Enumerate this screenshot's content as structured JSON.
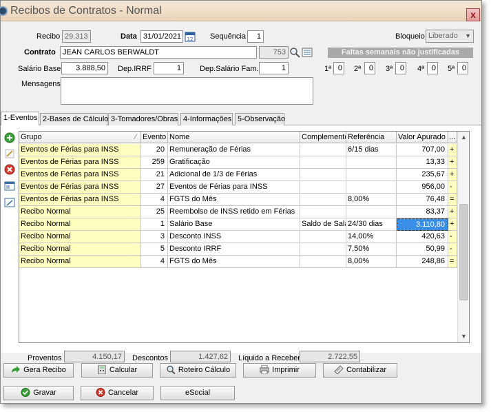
{
  "window": {
    "title": "Recibos de Contratos - Normal",
    "close_label": "x"
  },
  "header": {
    "recibo_label": "Recibo",
    "recibo_value": "29.313",
    "data_label": "Data",
    "data_value": "31/01/2021",
    "sequencia_label": "Sequência",
    "sequencia_value": "1",
    "bloqueio_label": "Bloqueio",
    "bloqueio_value": "Liberado",
    "contrato_label": "Contrato",
    "contrato_value": "JEAN CARLOS BERWALDT",
    "contrato_code": "753",
    "faltas_label": "Faltas semanais não justificadas",
    "salario_label": "Salário Base",
    "salario_value": "3.888,50",
    "depirrf_label": "Dep.IRRF",
    "depirrf_value": "1",
    "depsal_label": "Dep.Salário Fam.",
    "depsal_value": "1",
    "weeks": [
      {
        "label": "1ª",
        "value": "0"
      },
      {
        "label": "2ª",
        "value": "0"
      },
      {
        "label": "3ª",
        "value": "0"
      },
      {
        "label": "4ª",
        "value": "0"
      },
      {
        "label": "5ª",
        "value": "0"
      }
    ],
    "mensagens_label": "Mensagens",
    "mensagens_value": ""
  },
  "tabs": [
    "1-Eventos",
    "2-Bases de Cálculo",
    "3-Tomadores/Obras",
    "4-Informações",
    "5-Observação"
  ],
  "grid": {
    "columns": [
      "Grupo",
      "Evento",
      "Nome",
      "Complemento",
      "Referência",
      "Valor Apurado",
      "..."
    ],
    "sort_glyph": "∕",
    "rows": [
      {
        "grupo": "Eventos de Férias para INSS",
        "evento": "20",
        "nome": "Remuneração de Férias",
        "complemento": "",
        "referencia": "6/15 dias",
        "valor": "707,00",
        "sinal": "+"
      },
      {
        "grupo": "Eventos de Férias para INSS",
        "evento": "259",
        "nome": "Gratificação",
        "complemento": "",
        "referencia": "",
        "valor": "13,33",
        "sinal": "+"
      },
      {
        "grupo": "Eventos de Férias para INSS",
        "evento": "21",
        "nome": "Adicional de 1/3 de Férias",
        "complemento": "",
        "referencia": "",
        "valor": "235,67",
        "sinal": "+"
      },
      {
        "grupo": "Eventos de Férias para INSS",
        "evento": "27",
        "nome": "Eventos de Férias para INSS",
        "complemento": "",
        "referencia": "",
        "valor": "956,00",
        "sinal": "-"
      },
      {
        "grupo": "Eventos de Férias para INSS",
        "evento": "4",
        "nome": "FGTS do Mês",
        "complemento": "",
        "referencia": "8,00%",
        "valor": "76,48",
        "sinal": "="
      },
      {
        "grupo": "Recibo Normal",
        "evento": "25",
        "nome": "Reembolso de INSS retido em Férias",
        "complemento": "",
        "referencia": "",
        "valor": "83,37",
        "sinal": "+"
      },
      {
        "grupo": "Recibo Normal",
        "evento": "1",
        "nome": "Salário Base",
        "complemento": "Saldo de Salá",
        "referencia": "24/30 dias",
        "valor": "3.110,80",
        "sinal": "+"
      },
      {
        "grupo": "Recibo Normal",
        "evento": "3",
        "nome": "Desconto INSS",
        "complemento": "",
        "referencia": "14,00%",
        "valor": "420,63",
        "sinal": "-"
      },
      {
        "grupo": "Recibo Normal",
        "evento": "5",
        "nome": "Desconto IRRF",
        "complemento": "",
        "referencia": "7,50%",
        "valor": "50,99",
        "sinal": "-"
      },
      {
        "grupo": "Recibo Normal",
        "evento": "4",
        "nome": "FGTS do Mês",
        "complemento": "",
        "referencia": "8,00%",
        "valor": "248,86",
        "sinal": "="
      }
    ]
  },
  "totals": {
    "proventos_label": "Proventos",
    "proventos_value": "4.150,17",
    "descontos_label": "Descontos",
    "descontos_value": "1.427,62",
    "liquido_label": "Líquido a Receber",
    "liquido_value": "2.722,55"
  },
  "buttons": {
    "gera_recibo": "Gera Recibo",
    "calcular": "Calcular",
    "roteiro": "Roteiro Cálculo",
    "imprimir": "Imprimir",
    "contabilizar": "Contabilizar",
    "gravar": "Gravar",
    "cancelar": "Cancelar",
    "esocial": "eSocial"
  },
  "colors": {
    "yellow_cell": "#ffffc0",
    "selected_cell": "#3a8ee6",
    "title_bar": "#ead3b9",
    "faltas_bar": "#a9a9a9"
  }
}
